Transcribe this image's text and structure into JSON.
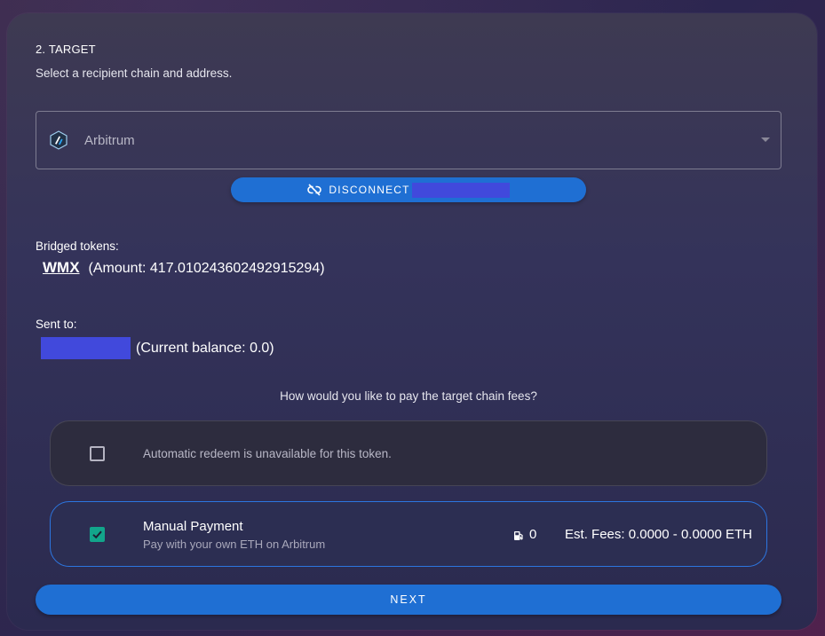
{
  "step": {
    "title": "2. TARGET",
    "subtitle": "Select a recipient chain and address."
  },
  "chain_select": {
    "selected": "Arbitrum",
    "logo_icon": "arbitrum-logo-icon"
  },
  "disconnect": {
    "label": "DISCONNECT",
    "icon": "link-off-icon"
  },
  "bridged": {
    "label": "Bridged tokens:",
    "token_symbol": "WMX",
    "amount_text": "(Amount: 417.010243602492915294)"
  },
  "sent_to": {
    "label": "Sent to:",
    "balance_text": "(Current balance: 0.0)"
  },
  "fees": {
    "question": "How would you like to pay the target chain fees?"
  },
  "options": {
    "automatic": {
      "text": "Automatic redeem is unavailable for this token.",
      "checked": false
    },
    "manual": {
      "title": "Manual Payment",
      "subtitle": "Pay with your own ETH on Arbitrum",
      "gas_value": "0",
      "gas_icon": "gas-pump-icon",
      "est_fees": "Est. Fees: 0.0000 - 0.0000 ETH",
      "checked": true
    }
  },
  "next": {
    "label": "NEXT"
  },
  "colors": {
    "accent_blue": "#1f6fd3",
    "check_green": "#12a58b",
    "redaction": "#4149dc"
  }
}
